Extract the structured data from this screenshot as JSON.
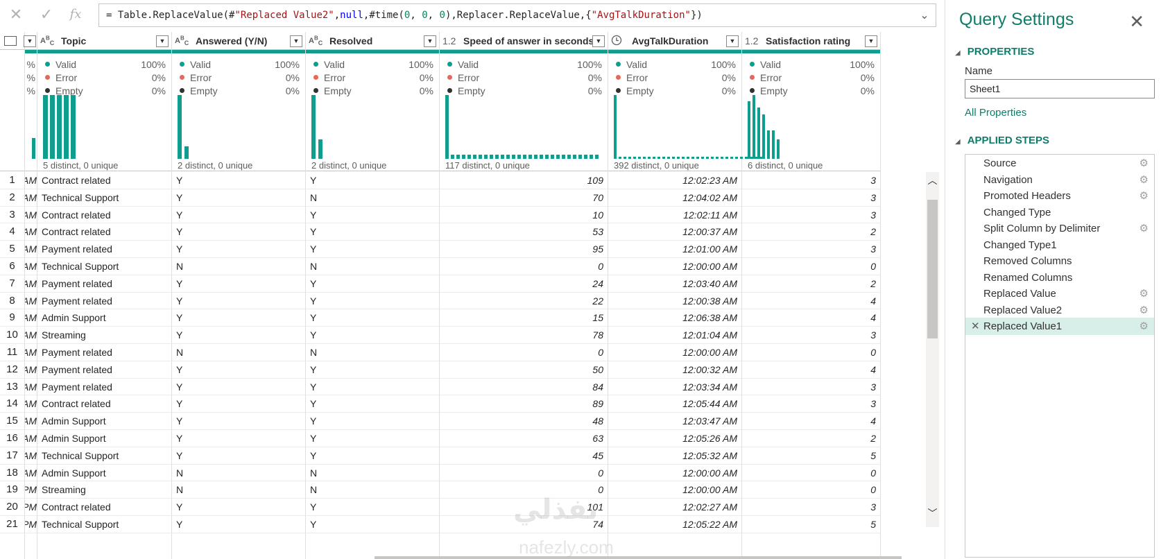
{
  "formula": {
    "prefix": "= Table.ReplaceValue(#",
    "str1": "\"Replaced Value2\"",
    "mid1": ",",
    "kw_null": "null",
    "mid2": ",#time(",
    "n0a": "0",
    "sep1": ", ",
    "n0b": "0",
    "sep2": ", ",
    "n0c": "0",
    "mid3": "),Replacer.ReplaceValue,{",
    "str2": "\"AvgTalkDuration\"",
    "suffix": "})"
  },
  "columns": [
    {
      "key": "topic",
      "type_icon": "ABC",
      "name": "Topic"
    },
    {
      "key": "answered",
      "type_icon": "ABC",
      "name": "Answered (Y/N)"
    },
    {
      "key": "resolved",
      "type_icon": "ABC",
      "name": "Resolved"
    },
    {
      "key": "speed",
      "type_icon": "1.2",
      "name": "Speed of answer in seconds"
    },
    {
      "key": "avgtalk",
      "type_icon": "clock",
      "name": "AvgTalkDuration"
    },
    {
      "key": "satisfaction",
      "type_icon": "1.2",
      "name": "Satisfaction rating"
    }
  ],
  "profile": {
    "valid_label": "Valid",
    "error_label": "Error",
    "empty_label": "Empty",
    "valid_pct": "100%",
    "error_pct": "0%",
    "empty_pct": "0%",
    "partial_pct": "%",
    "distinct": {
      "topic": "5 distinct, 0 unique",
      "answered": "2 distinct, 0 unique",
      "resolved": "2 distinct, 0 unique",
      "speed": "117 distinct, 0 unique",
      "avgtalk": "392 distinct, 0 unique",
      "satisfaction": "6 distinct, 0 unique"
    }
  },
  "rows": [
    {
      "n": "1",
      "ampm": "AM",
      "topic": "Contract related",
      "answered": "Y",
      "resolved": "Y",
      "speed": "109",
      "avgtalk": "12:02:23 AM",
      "satisfaction": "3"
    },
    {
      "n": "2",
      "ampm": "AM",
      "topic": "Technical Support",
      "answered": "Y",
      "resolved": "N",
      "speed": "70",
      "avgtalk": "12:04:02 AM",
      "satisfaction": "3"
    },
    {
      "n": "3",
      "ampm": "AM",
      "topic": "Contract related",
      "answered": "Y",
      "resolved": "Y",
      "speed": "10",
      "avgtalk": "12:02:11 AM",
      "satisfaction": "3"
    },
    {
      "n": "4",
      "ampm": "AM",
      "topic": "Contract related",
      "answered": "Y",
      "resolved": "Y",
      "speed": "53",
      "avgtalk": "12:00:37 AM",
      "satisfaction": "2"
    },
    {
      "n": "5",
      "ampm": "AM",
      "topic": "Payment related",
      "answered": "Y",
      "resolved": "Y",
      "speed": "95",
      "avgtalk": "12:01:00 AM",
      "satisfaction": "3"
    },
    {
      "n": "6",
      "ampm": "AM",
      "topic": "Technical Support",
      "answered": "N",
      "resolved": "N",
      "speed": "0",
      "avgtalk": "12:00:00 AM",
      "satisfaction": "0"
    },
    {
      "n": "7",
      "ampm": "AM",
      "topic": "Payment related",
      "answered": "Y",
      "resolved": "Y",
      "speed": "24",
      "avgtalk": "12:03:40 AM",
      "satisfaction": "2"
    },
    {
      "n": "8",
      "ampm": "AM",
      "topic": "Payment related",
      "answered": "Y",
      "resolved": "Y",
      "speed": "22",
      "avgtalk": "12:00:38 AM",
      "satisfaction": "4"
    },
    {
      "n": "9",
      "ampm": "AM",
      "topic": "Admin Support",
      "answered": "Y",
      "resolved": "Y",
      "speed": "15",
      "avgtalk": "12:06:38 AM",
      "satisfaction": "4"
    },
    {
      "n": "10",
      "ampm": "AM",
      "topic": "Streaming",
      "answered": "Y",
      "resolved": "Y",
      "speed": "78",
      "avgtalk": "12:01:04 AM",
      "satisfaction": "3"
    },
    {
      "n": "11",
      "ampm": "AM",
      "topic": "Payment related",
      "answered": "N",
      "resolved": "N",
      "speed": "0",
      "avgtalk": "12:00:00 AM",
      "satisfaction": "0"
    },
    {
      "n": "12",
      "ampm": "AM",
      "topic": "Payment related",
      "answered": "Y",
      "resolved": "Y",
      "speed": "50",
      "avgtalk": "12:00:32 AM",
      "satisfaction": "4"
    },
    {
      "n": "13",
      "ampm": "AM",
      "topic": "Payment related",
      "answered": "Y",
      "resolved": "Y",
      "speed": "84",
      "avgtalk": "12:03:34 AM",
      "satisfaction": "3"
    },
    {
      "n": "14",
      "ampm": "AM",
      "topic": "Contract related",
      "answered": "Y",
      "resolved": "Y",
      "speed": "89",
      "avgtalk": "12:05:44 AM",
      "satisfaction": "3"
    },
    {
      "n": "15",
      "ampm": "AM",
      "topic": "Admin Support",
      "answered": "Y",
      "resolved": "Y",
      "speed": "48",
      "avgtalk": "12:03:47 AM",
      "satisfaction": "4"
    },
    {
      "n": "16",
      "ampm": "AM",
      "topic": "Admin Support",
      "answered": "Y",
      "resolved": "Y",
      "speed": "63",
      "avgtalk": "12:05:26 AM",
      "satisfaction": "2"
    },
    {
      "n": "17",
      "ampm": "AM",
      "topic": "Technical Support",
      "answered": "Y",
      "resolved": "Y",
      "speed": "45",
      "avgtalk": "12:05:32 AM",
      "satisfaction": "5"
    },
    {
      "n": "18",
      "ampm": "AM",
      "topic": "Admin Support",
      "answered": "N",
      "resolved": "N",
      "speed": "0",
      "avgtalk": "12:00:00 AM",
      "satisfaction": "0"
    },
    {
      "n": "19",
      "ampm": "PM",
      "topic": "Streaming",
      "answered": "N",
      "resolved": "N",
      "speed": "0",
      "avgtalk": "12:00:00 AM",
      "satisfaction": "0"
    },
    {
      "n": "20",
      "ampm": "PM",
      "topic": "Contract related",
      "answered": "Y",
      "resolved": "Y",
      "speed": "101",
      "avgtalk": "12:02:27 AM",
      "satisfaction": "3"
    },
    {
      "n": "21",
      "ampm": "PM",
      "topic": "Technical Support",
      "answered": "Y",
      "resolved": "Y",
      "speed": "74",
      "avgtalk": "12:05:22 AM",
      "satisfaction": "5"
    }
  ],
  "settings": {
    "title": "Query Settings",
    "properties_label": "PROPERTIES",
    "name_label": "Name",
    "name_value": "Sheet1",
    "all_properties": "All Properties",
    "applied_steps_label": "APPLIED STEPS",
    "steps": [
      {
        "label": "Source",
        "gear": true
      },
      {
        "label": "Navigation",
        "gear": true
      },
      {
        "label": "Promoted Headers",
        "gear": true
      },
      {
        "label": "Changed Type",
        "gear": false
      },
      {
        "label": "Split Column by Delimiter",
        "gear": true
      },
      {
        "label": "Changed Type1",
        "gear": false
      },
      {
        "label": "Removed Columns",
        "gear": false
      },
      {
        "label": "Renamed Columns",
        "gear": false
      },
      {
        "label": "Replaced Value",
        "gear": true
      },
      {
        "label": "Replaced Value2",
        "gear": true
      },
      {
        "label": "Replaced Value1",
        "gear": true,
        "active": true
      }
    ]
  },
  "watermark": {
    "arabic": "نفذلي",
    "latin": "nafezly.com"
  },
  "icons": {
    "cancel": "close-icon",
    "commit": "check-icon",
    "fx": "fx-icon",
    "gear": "gear-icon"
  },
  "colors": {
    "teal": "#0f9d8e",
    "valid": "#0f9d8e",
    "error": "#e8675c",
    "empty": "#323130",
    "accent": "#107c6a"
  }
}
